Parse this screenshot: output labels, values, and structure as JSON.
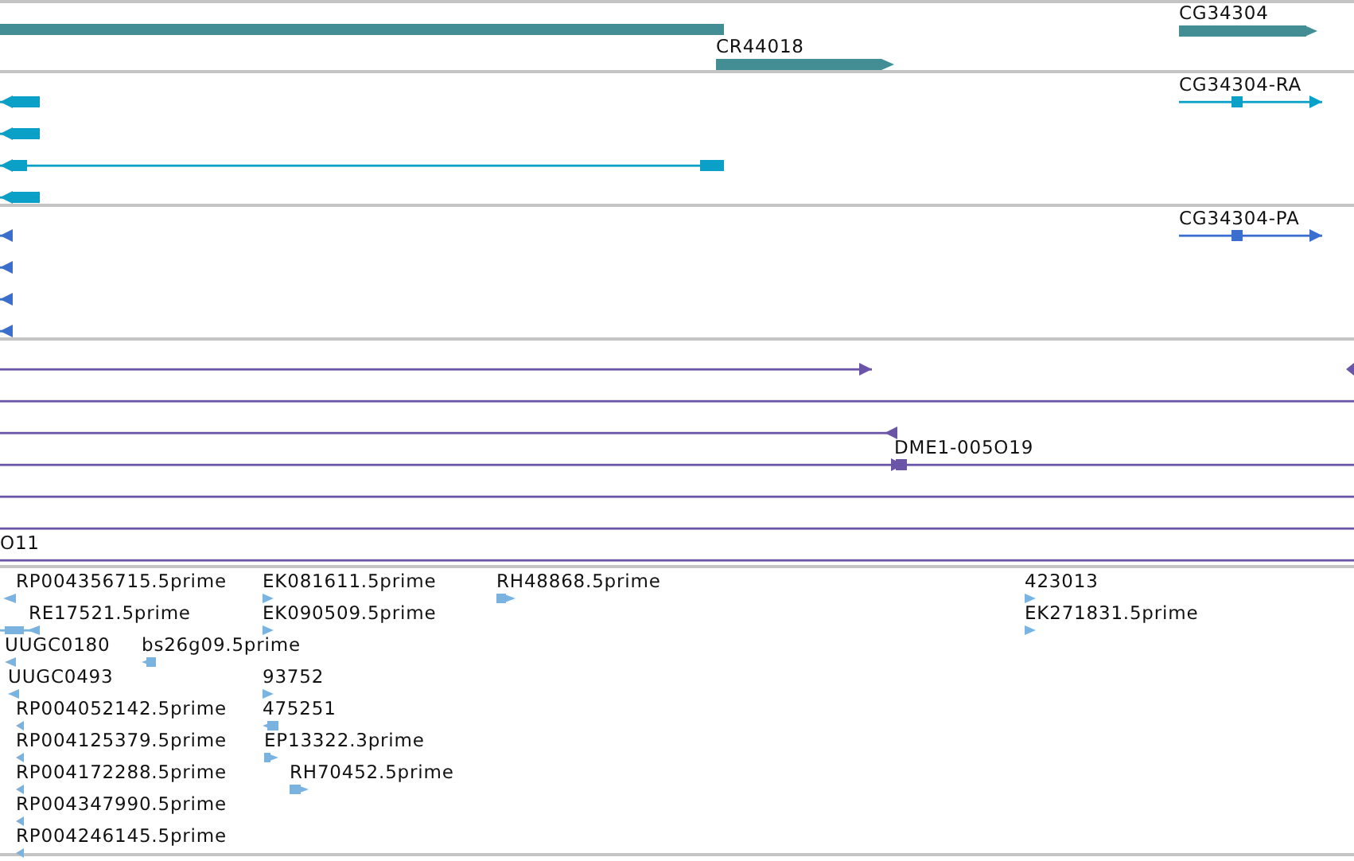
{
  "tracks": [
    {
      "kind": "gene",
      "features": [
        {
          "kind": "plain"
        },
        {
          "kind": "arrow",
          "label": "CR44018",
          "points_left": false
        },
        {
          "kind": "arrow",
          "label": "CG34304",
          "points_left": false
        }
      ]
    },
    {
      "kind": "transcript",
      "features": [
        {
          "kind": "arrow",
          "points_left": true
        },
        {
          "kind": "arrow",
          "points_left": true
        },
        {
          "kind": "arrow",
          "points_left": true
        },
        {
          "kind": "arrow",
          "points_left": true
        },
        {
          "kind": "arrow",
          "label": "CG34304-RA",
          "points_left": false
        }
      ]
    },
    {
      "kind": "protein",
      "features": [
        {
          "kind": "arrow",
          "points_left": true
        },
        {
          "kind": "arrow",
          "points_left": true
        },
        {
          "kind": "arrow",
          "points_left": true
        },
        {
          "kind": "arrow",
          "points_left": true
        },
        {
          "kind": "arrow",
          "label": "CG34304-PA",
          "points_left": false
        }
      ]
    },
    {
      "kind": "match",
      "features": [
        {
          "kind": "arrow",
          "points_left": false
        },
        {
          "kind": "arrow",
          "points_left": true
        },
        {
          "kind": "plain"
        },
        {
          "kind": "arrow",
          "points_left": true
        },
        {
          "kind": "arrow",
          "label": "DME1-005O19",
          "points_left": false
        },
        {
          "kind": "plain"
        },
        {
          "kind": "plain"
        },
        {
          "kind": "plain",
          "label": "O11"
        }
      ]
    },
    {
      "kind": "est",
      "features": [
        {
          "kind": "arrow",
          "label": "RP004356715.5prime",
          "points_left": true
        },
        {
          "kind": "arrow",
          "label": "EK081611.5prime",
          "points_left": false
        },
        {
          "kind": "arrow",
          "label": "RH48868.5prime",
          "points_left": false
        },
        {
          "kind": "arrow",
          "label": "423013",
          "points_left": false
        },
        {
          "kind": "arrow",
          "label": "RE17521.5prime",
          "points_left": true
        },
        {
          "kind": "arrow",
          "label": "EK090509.5prime",
          "points_left": false
        },
        {
          "kind": "arrow",
          "label": "EK271831.5prime",
          "points_left": false
        },
        {
          "kind": "arrow",
          "label": "UUGC0180",
          "points_left": true
        },
        {
          "kind": "arrow",
          "label": "bs26g09.5prime",
          "points_left": true
        },
        {
          "kind": "arrow",
          "label": "UUGC0493",
          "points_left": true
        },
        {
          "kind": "arrow",
          "label": "93752",
          "points_left": false
        },
        {
          "kind": "arrow",
          "label": "RP004052142.5prime",
          "points_left": true
        },
        {
          "kind": "arrow",
          "label": "475251",
          "points_left": true
        },
        {
          "kind": "arrow",
          "label": "RP004125379.5prime",
          "points_left": true
        },
        {
          "kind": "arrow",
          "label": "EP13322.3prime",
          "points_left": false
        },
        {
          "kind": "arrow",
          "label": "RP004172288.5prime",
          "points_left": true
        },
        {
          "kind": "arrow",
          "label": "RH70452.5prime",
          "points_left": false
        },
        {
          "kind": "arrow",
          "label": "RP004347990.5prime",
          "points_left": true
        },
        {
          "kind": "arrow",
          "label": "RP004246145.5prime",
          "points_left": true
        }
      ]
    }
  ]
}
